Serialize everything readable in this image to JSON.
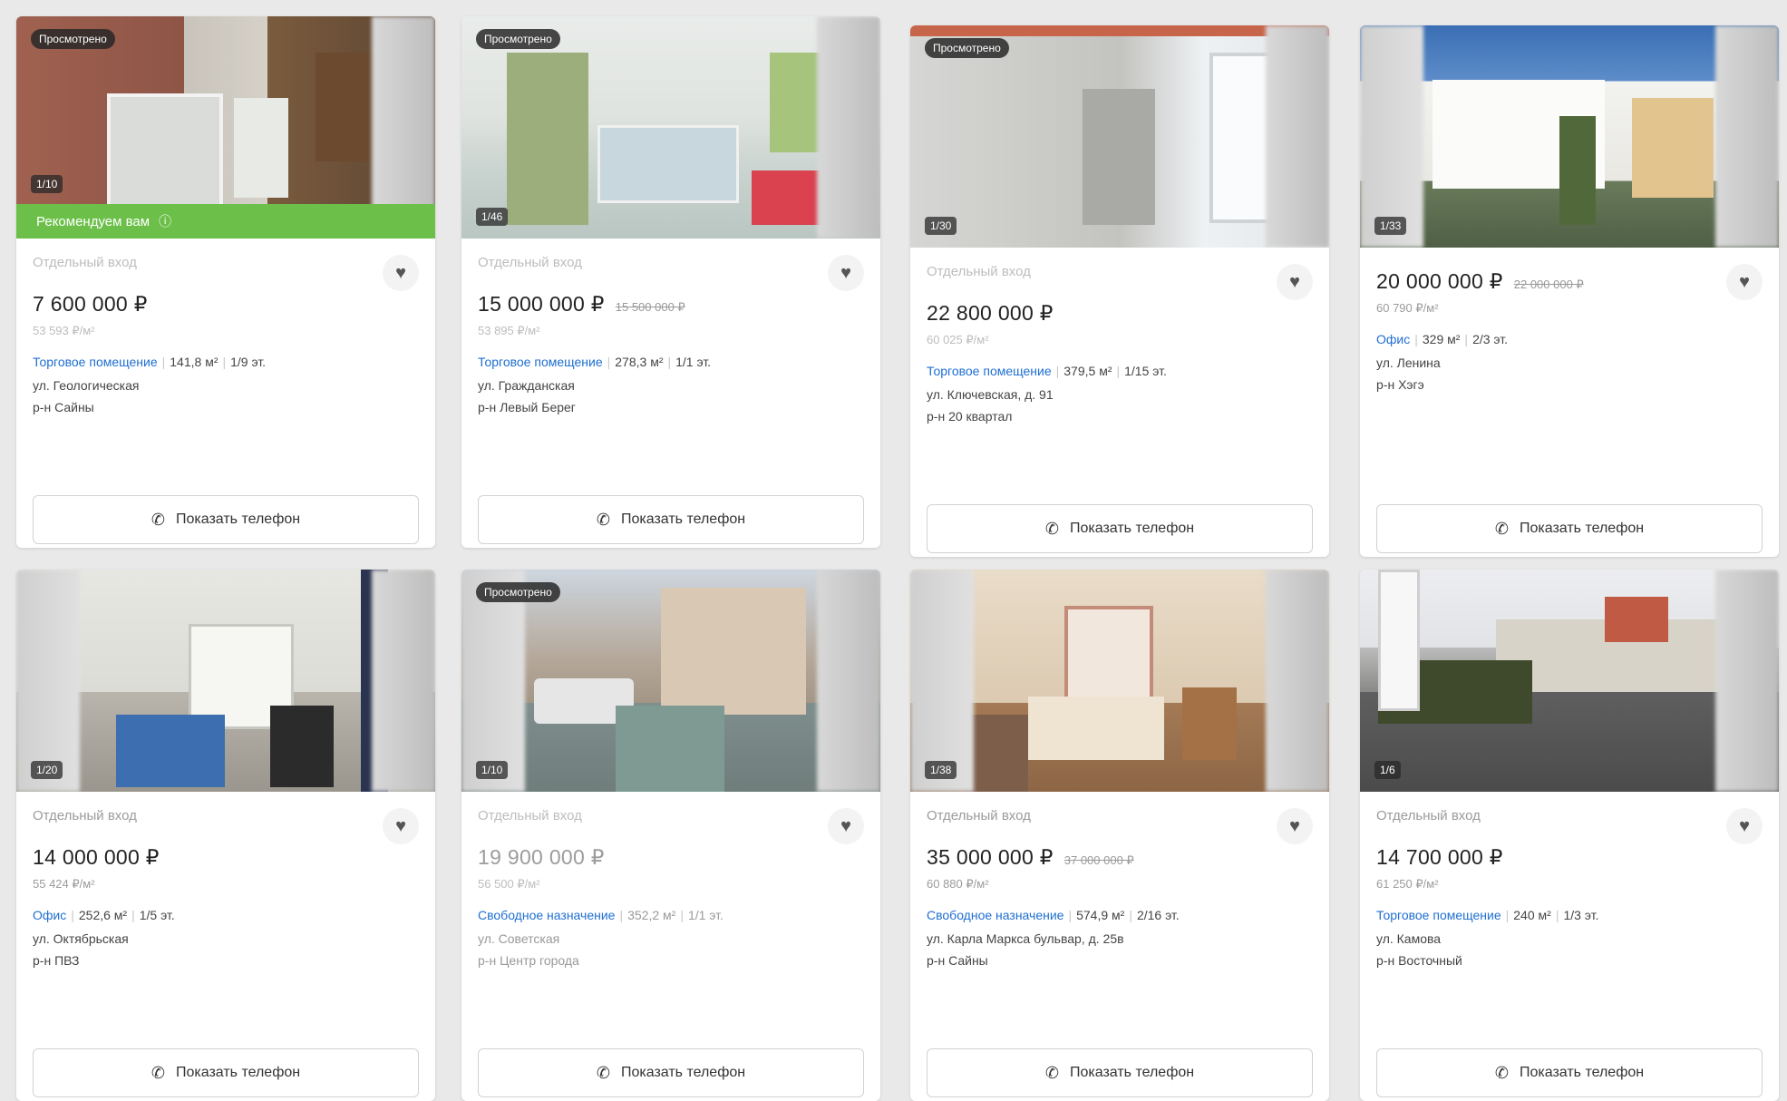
{
  "listings": [
    {
      "viewed_badge": "Просмотрено",
      "counter": "1/10",
      "recommend": "Рекомендуем вам",
      "entrance": "Отдельный вход",
      "price": "7 600 000 ₽",
      "old_price": "",
      "per_m": "53 593 ₽/м²",
      "type": "Торговое помещение",
      "area": "141,8 м²",
      "floor": "1/9 эт.",
      "address": "ул. Геологическая",
      "district": "р-н Сайны",
      "phone_label": "Показать телефон"
    },
    {
      "viewed_badge": "Просмотрено",
      "counter": "1/46",
      "recommend": "",
      "entrance": "Отдельный вход",
      "price": "15 000 000 ₽",
      "old_price": "15 500 000 ₽",
      "per_m": "53 895 ₽/м²",
      "type": "Торговое помещение",
      "area": "278,3 м²",
      "floor": "1/1 эт.",
      "address": "ул. Гражданская",
      "district": "р-н Левый Берег",
      "phone_label": "Показать телефон"
    },
    {
      "viewed_badge": "Просмотрено",
      "counter": "1/30",
      "recommend": "",
      "entrance": "Отдельный вход",
      "price": "22 800 000 ₽",
      "old_price": "",
      "per_m": "60 025 ₽/м²",
      "type": "Торговое помещение",
      "area": "379,5 м²",
      "floor": "1/15 эт.",
      "address": "ул. Ключевская, д. 91",
      "district": "р-н 20 квартал",
      "phone_label": "Показать телефон"
    },
    {
      "viewed_badge": "",
      "counter": "1/33",
      "recommend": "",
      "entrance": "",
      "price": "20 000 000 ₽",
      "old_price": "22 000 000 ₽",
      "per_m": "60 790 ₽/м²",
      "type": "Офис",
      "area": "329 м²",
      "floor": "2/3 эт.",
      "address": "ул. Ленина",
      "district": "р-н Хэгэ",
      "phone_label": "Показать телефон"
    },
    {
      "viewed_badge": "",
      "counter": "1/20",
      "recommend": "",
      "entrance": "Отдельный вход",
      "price": "14 000 000 ₽",
      "old_price": "",
      "per_m": "55 424 ₽/м²",
      "type": "Офис",
      "area": "252,6 м²",
      "floor": "1/5 эт.",
      "address": "ул. Октябрьская",
      "district": "р-н ПВЗ",
      "phone_label": "Показать телефон"
    },
    {
      "viewed_badge": "Просмотрено",
      "counter": "1/10",
      "recommend": "",
      "entrance": "Отдельный вход",
      "price": "19 900 000 ₽",
      "old_price": "",
      "per_m": "56 500 ₽/м²",
      "type": "Свободное назначение",
      "area": "352,2 м²",
      "floor": "1/1 эт.",
      "address": "ул. Советская",
      "district": "р-н Центр города",
      "phone_label": "Показать телефон"
    },
    {
      "viewed_badge": "",
      "counter": "1/38",
      "recommend": "",
      "entrance": "Отдельный вход",
      "price": "35 000 000 ₽",
      "old_price": "37 000 000 ₽",
      "per_m": "60 880 ₽/м²",
      "type": "Свободное назначение",
      "area": "574,9 м²",
      "floor": "2/16 эт.",
      "address": "ул. Карла Маркса бульвар, д. 25в",
      "district": "р-н Сайны",
      "phone_label": "Показать телефон"
    },
    {
      "viewed_badge": "",
      "counter": "1/6",
      "recommend": "",
      "entrance": "Отдельный вход",
      "price": "14 700 000 ₽",
      "old_price": "",
      "per_m": "61 250 ₽/м²",
      "type": "Торговое помещение",
      "area": "240 м²",
      "floor": "1/3 эт.",
      "address": "ул. Камова",
      "district": "р-н Восточный",
      "phone_label": "Показать телефон"
    }
  ],
  "colors": {
    "accent_blue": "#1f6fd1",
    "recommend_green": "#6cc04a"
  }
}
